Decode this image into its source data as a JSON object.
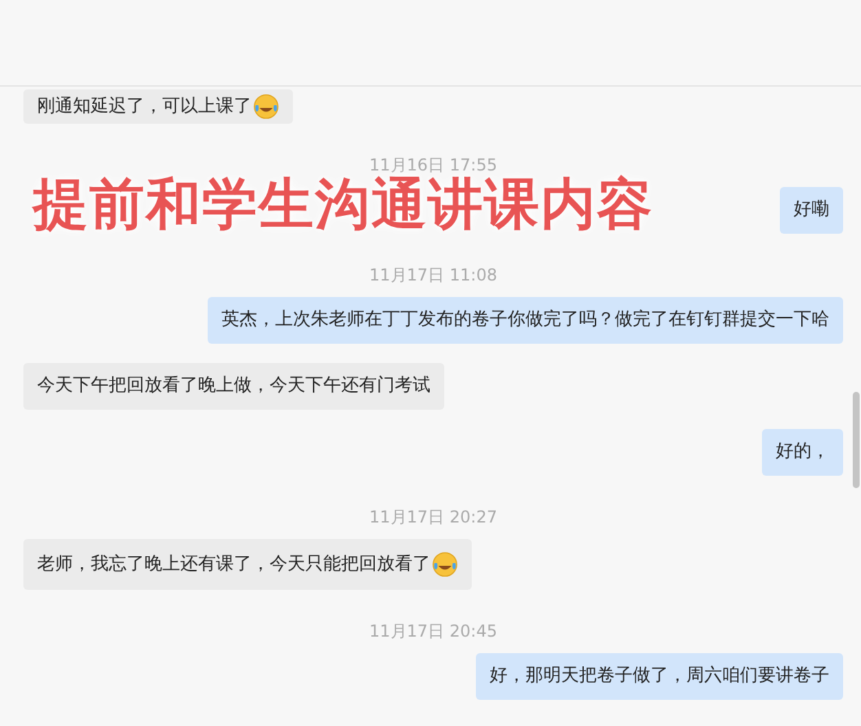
{
  "messages": [
    {
      "kind": "in",
      "text": "刚通知延迟了，可以上课了",
      "emoji": true
    },
    {
      "kind": "time",
      "text": "11月16日 17:55"
    },
    {
      "kind": "out",
      "text": "好嘞",
      "emoji": false
    },
    {
      "kind": "time",
      "text": "11月17日 11:08"
    },
    {
      "kind": "out",
      "text": "英杰，上次朱老师在丁丁发布的卷子你做完了吗？做完了在钉钉群提交一下哈",
      "emoji": false
    },
    {
      "kind": "in",
      "text": "今天下午把回放看了晚上做，今天下午还有门考试",
      "emoji": false
    },
    {
      "kind": "out",
      "text": "好的，",
      "emoji": false
    },
    {
      "kind": "time",
      "text": "11月17日 20:27"
    },
    {
      "kind": "in",
      "text": "老师，我忘了晚上还有课了，今天只能把回放看了",
      "emoji": true
    },
    {
      "kind": "time",
      "text": "11月17日 20:45"
    },
    {
      "kind": "out",
      "text": "好，那明天把卷子做了，周六咱们要讲卷子",
      "emoji": false
    }
  ],
  "caption": "提前和学生沟通讲课内容"
}
